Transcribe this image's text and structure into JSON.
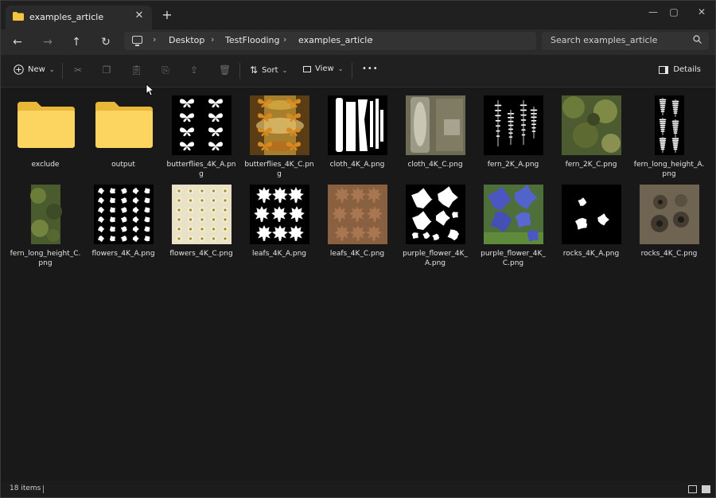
{
  "window": {
    "tab_title": "examples_article",
    "tab_close": "✕",
    "new_tab": "+",
    "minimize": "—",
    "maximize": "▢",
    "close": "✕"
  },
  "nav": {
    "back": "←",
    "forward": "→",
    "up": "↑",
    "refresh": "↻",
    "breadcrumbs": [
      "Desktop",
      "TestFlooding",
      "examples_article"
    ],
    "search_placeholder": "Search examples_article"
  },
  "toolbar": {
    "new_label": "New",
    "sort_label": "Sort",
    "view_label": "View",
    "more_label": "•••",
    "details_label": "Details"
  },
  "files": [
    {
      "name": "exclude",
      "kind": "folder"
    },
    {
      "name": "output",
      "kind": "folder"
    },
    {
      "name": "butterflies_4K_A.png",
      "kind": "butterflies_mask"
    },
    {
      "name": "butterflies_4K_C.png",
      "kind": "butterflies_color"
    },
    {
      "name": "cloth_4K_A.png",
      "kind": "cloth_mask"
    },
    {
      "name": "cloth_4K_C.png",
      "kind": "cloth_color"
    },
    {
      "name": "fern_2K_A.png",
      "kind": "fern_mask"
    },
    {
      "name": "fern_2K_C.png",
      "kind": "fern_color"
    },
    {
      "name": "fern_long_height_A.png",
      "kind": "fern_long_mask"
    },
    {
      "name": "fern_long_height_C.png",
      "kind": "fern_long_color"
    },
    {
      "name": "flowers_4K_A.png",
      "kind": "flowers_mask"
    },
    {
      "name": "flowers_4K_C.png",
      "kind": "flowers_color"
    },
    {
      "name": "leafs_4K_A.png",
      "kind": "leafs_mask"
    },
    {
      "name": "leafs_4K_C.png",
      "kind": "leafs_color"
    },
    {
      "name": "purple_flower_4K_A.png",
      "kind": "purple_mask"
    },
    {
      "name": "purple_flower_4K_C.png",
      "kind": "purple_color"
    },
    {
      "name": "rocks_4K_A.png",
      "kind": "rocks_mask"
    },
    {
      "name": "rocks_4K_C.png",
      "kind": "rocks_color"
    }
  ],
  "status": {
    "item_count": "18 items"
  },
  "colors": {
    "folder": "#f4c542",
    "background": "#191919",
    "toolbar": "#202020"
  }
}
